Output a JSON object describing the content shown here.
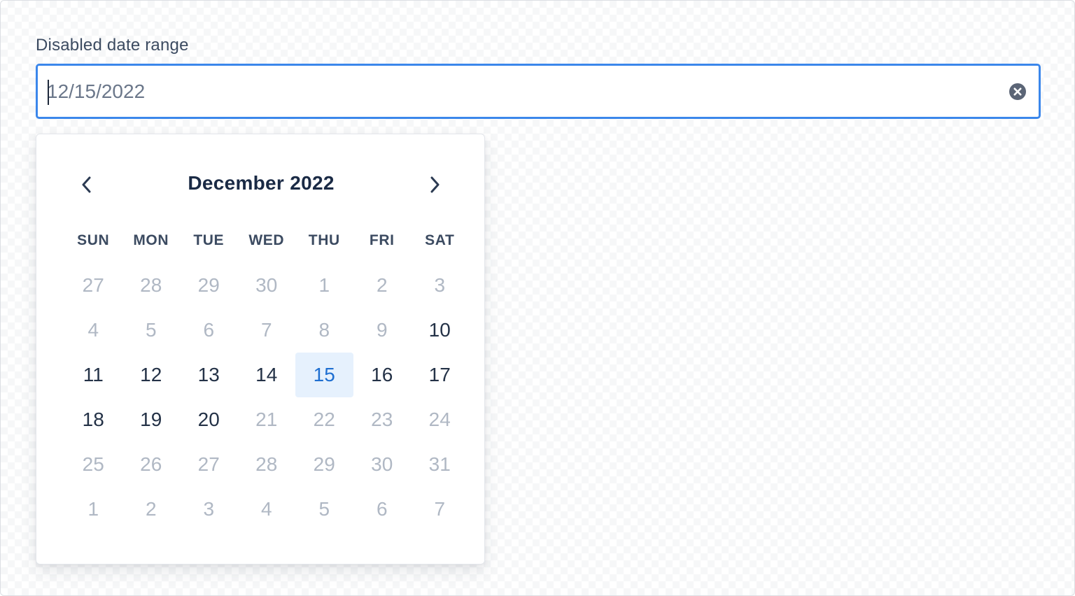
{
  "field": {
    "label": "Disabled date range",
    "value": "12/15/2022"
  },
  "icons": {
    "clear": "close-circle-icon",
    "prev": "chevron-left-icon",
    "next": "chevron-right-icon"
  },
  "colors": {
    "focus_border": "#3b87eb",
    "selected_bg": "#e6f1fd",
    "selected_text": "#1f6fd1",
    "disabled_text": "#b0b8c4",
    "enabled_text": "#243247"
  },
  "calendar": {
    "month_label": "December 2022",
    "weekdays": [
      "SUN",
      "MON",
      "TUE",
      "WED",
      "THU",
      "FRI",
      "SAT"
    ],
    "weeks": [
      [
        {
          "label": "27",
          "enabled": false
        },
        {
          "label": "28",
          "enabled": false
        },
        {
          "label": "29",
          "enabled": false
        },
        {
          "label": "30",
          "enabled": false
        },
        {
          "label": "1",
          "enabled": false
        },
        {
          "label": "2",
          "enabled": false
        },
        {
          "label": "3",
          "enabled": false
        }
      ],
      [
        {
          "label": "4",
          "enabled": false
        },
        {
          "label": "5",
          "enabled": false
        },
        {
          "label": "6",
          "enabled": false
        },
        {
          "label": "7",
          "enabled": false
        },
        {
          "label": "8",
          "enabled": false
        },
        {
          "label": "9",
          "enabled": false
        },
        {
          "label": "10",
          "enabled": true
        }
      ],
      [
        {
          "label": "11",
          "enabled": true
        },
        {
          "label": "12",
          "enabled": true
        },
        {
          "label": "13",
          "enabled": true
        },
        {
          "label": "14",
          "enabled": true
        },
        {
          "label": "15",
          "enabled": true,
          "selected": true
        },
        {
          "label": "16",
          "enabled": true
        },
        {
          "label": "17",
          "enabled": true
        }
      ],
      [
        {
          "label": "18",
          "enabled": true
        },
        {
          "label": "19",
          "enabled": true
        },
        {
          "label": "20",
          "enabled": true
        },
        {
          "label": "21",
          "enabled": false
        },
        {
          "label": "22",
          "enabled": false
        },
        {
          "label": "23",
          "enabled": false
        },
        {
          "label": "24",
          "enabled": false
        }
      ],
      [
        {
          "label": "25",
          "enabled": false
        },
        {
          "label": "26",
          "enabled": false
        },
        {
          "label": "27",
          "enabled": false
        },
        {
          "label": "28",
          "enabled": false
        },
        {
          "label": "29",
          "enabled": false
        },
        {
          "label": "30",
          "enabled": false
        },
        {
          "label": "31",
          "enabled": false
        }
      ],
      [
        {
          "label": "1",
          "enabled": false
        },
        {
          "label": "2",
          "enabled": false
        },
        {
          "label": "3",
          "enabled": false
        },
        {
          "label": "4",
          "enabled": false
        },
        {
          "label": "5",
          "enabled": false
        },
        {
          "label": "6",
          "enabled": false
        },
        {
          "label": "7",
          "enabled": false
        }
      ]
    ]
  }
}
